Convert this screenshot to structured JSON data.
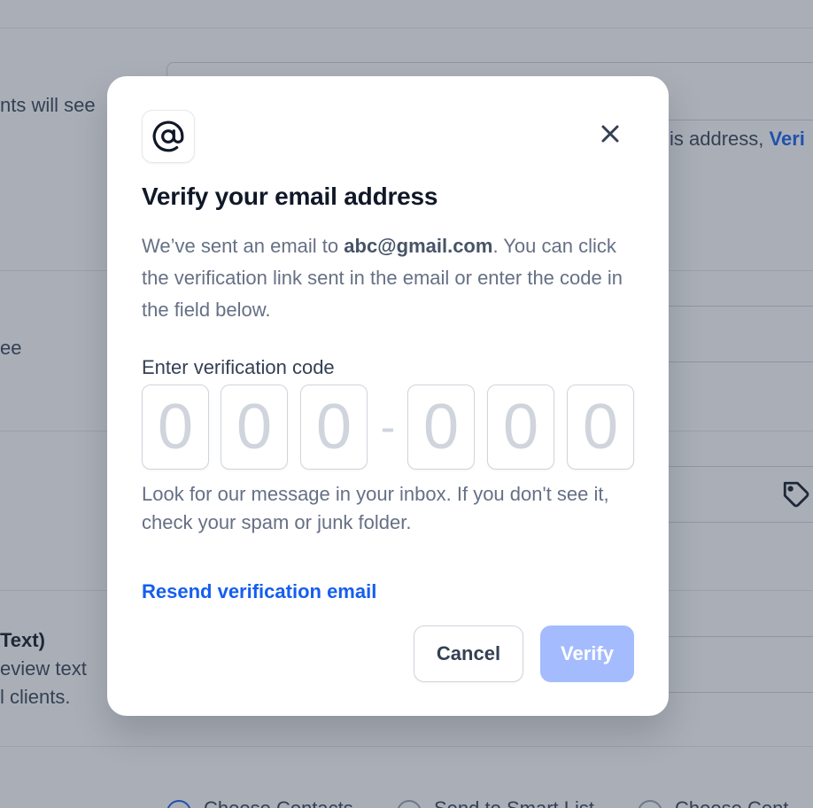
{
  "background": {
    "frag_clients_see": "nts will see",
    "frag_address": "is address,",
    "frag_verify_link": "Veri",
    "frag_see": "ee",
    "frag_text_heading": "Text)",
    "frag_preview_text": "eview text",
    "frag_clients": "l clients.",
    "radio_choose_contacts": "Choose Contacts",
    "radio_smart_list": "Send to Smart List",
    "radio_choose_cont": "Choose Cont"
  },
  "modal": {
    "icon": "at-sign-icon",
    "title": "Verify your email address",
    "desc_prefix": "We’ve sent an email to ",
    "email": "abc@gmail.com",
    "desc_suffix": ". You can click the verification link sent in the email or enter the code in the field below.",
    "code_label": "Enter verification code",
    "digits": [
      "0",
      "0",
      "0",
      "0",
      "0",
      "0"
    ],
    "dash": "-",
    "hint": "Look for our message in your inbox. If you don't see it, check your spam or junk folder.",
    "resend_label": "Resend verification email",
    "cancel_label": "Cancel",
    "verify_label": "Verify"
  },
  "colors": {
    "accent": "#155eef",
    "verify_disabled": "#a4bcfd",
    "overlay": "rgba(52,64,84,0.42)"
  }
}
